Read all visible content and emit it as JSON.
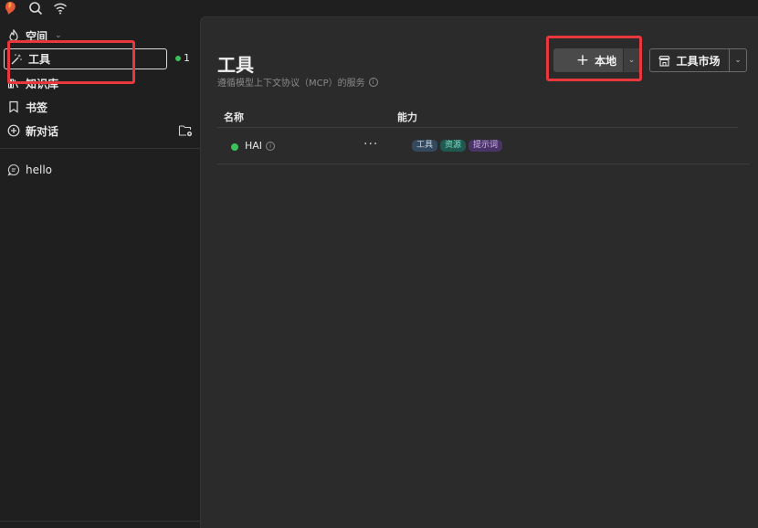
{
  "topbar": {
    "logo_icon": "app-logo-icon",
    "search_icon": "search-icon",
    "wifi_icon": "wifi-icon"
  },
  "sidebar": {
    "space": {
      "label": "空间",
      "icon": "flame-icon"
    },
    "tools": {
      "label": "工具",
      "icon": "magic-wand-icon",
      "badge_count": "1"
    },
    "knowledge": {
      "label": "知识库",
      "icon": "library-icon"
    },
    "bookmarks": {
      "label": "书签",
      "icon": "bookmark-icon"
    },
    "new_chat": {
      "label": "新对话",
      "icon": "plus-circle-icon"
    },
    "conversations": [
      {
        "label": "hello",
        "icon": "chat-icon"
      }
    ]
  },
  "main": {
    "title": "工具",
    "subtitle": "遵循模型上下文协议（MCP）的服务",
    "local_button": {
      "label": "本地"
    },
    "market_button": {
      "label": "工具市场"
    },
    "table": {
      "columns": [
        "名称",
        "能力"
      ],
      "rows": [
        {
          "name": "HAI",
          "status": "online",
          "capabilities": [
            "工具",
            "资源",
            "提示词"
          ]
        }
      ]
    }
  },
  "colors": {
    "accent_highlight": "#e8383d",
    "status_online": "#3cc15a",
    "tag_tool": "#34495e",
    "tag_resource": "#1f5950",
    "tag_prompt": "#4a3366"
  }
}
